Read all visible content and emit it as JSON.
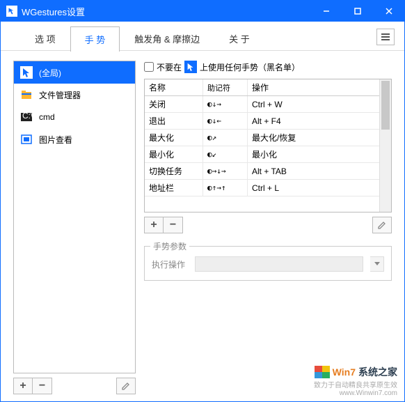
{
  "window": {
    "title": "WGestures设置"
  },
  "tabs": [
    "选 项",
    "手 势",
    "触发角 & 摩擦边",
    "关 于"
  ],
  "active_tab": 1,
  "apps": [
    {
      "name": "(全局)",
      "selected": true,
      "icon": "cursor"
    },
    {
      "name": "文件管理器",
      "selected": false,
      "icon": "folder"
    },
    {
      "name": "cmd",
      "selected": false,
      "icon": "terminal"
    },
    {
      "name": "图片查看",
      "selected": false,
      "icon": "image"
    }
  ],
  "blacklist": {
    "prefix": "不要在",
    "suffix": "上使用任何手势（黑名单）",
    "checked": false
  },
  "gesture_headers": {
    "name": "名称",
    "mnemonic": "助记符",
    "action": "操作"
  },
  "gestures": [
    {
      "name": "关闭",
      "mnemonic": "◐↓→",
      "action": "Ctrl + W"
    },
    {
      "name": "退出",
      "mnemonic": "◐↓←",
      "action": "Alt + F4"
    },
    {
      "name": "最大化",
      "mnemonic": "◐↗",
      "action": "最大化/恢复"
    },
    {
      "name": "最小化",
      "mnemonic": "◐↙",
      "action": "最小化"
    },
    {
      "name": "切换任务",
      "mnemonic": "◐→↓→",
      "action": "Alt + TAB"
    },
    {
      "name": "地址栏",
      "mnemonic": "◐↑→↑",
      "action": "Ctrl + L"
    }
  ],
  "params": {
    "legend": "手势参数",
    "action_label": "执行操作",
    "action_value": ""
  },
  "watermark": {
    "brand1": "Win7",
    "brand2": "系统之家",
    "tagline": "致力于自动精良共享原生效",
    "url": "www.Winwin7.com"
  }
}
